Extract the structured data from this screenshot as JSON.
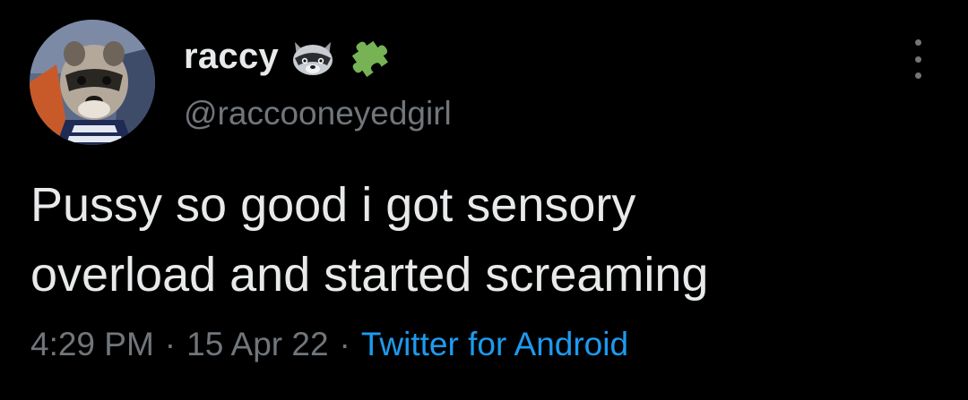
{
  "tweet": {
    "author": {
      "display_name": "raccy",
      "name_emojis": [
        "raccoon-emoji",
        "puzzle-piece-emoji"
      ],
      "handle": "@raccooneyedgirl"
    },
    "text_lines": [
      "Pussy so good i got sensory",
      "overload and started screaming"
    ],
    "time": "4:29 PM",
    "separator": "·",
    "date": "15 Apr 22",
    "source": "Twitter for Android"
  },
  "colors": {
    "background": "#000000",
    "primary_text": "#e7e9ea",
    "secondary_text": "#71767b",
    "link": "#1d9bf0",
    "puzzle_green": "#77b255"
  },
  "icons": {
    "more": "more-options-icon"
  }
}
